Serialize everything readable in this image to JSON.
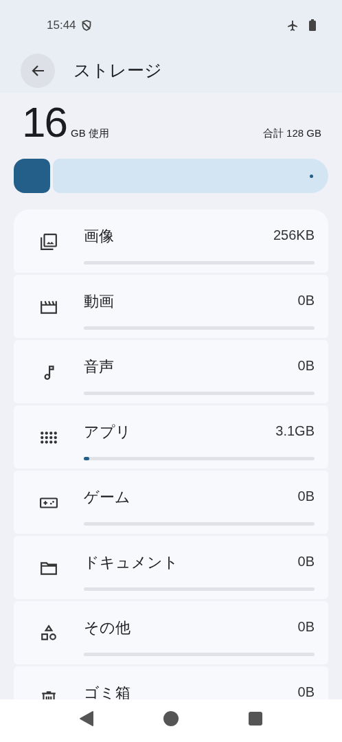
{
  "status_bar": {
    "time": "15:44"
  },
  "app_bar": {
    "title": "ストレージ"
  },
  "summary": {
    "used": "16",
    "used_unit": "GB 使用",
    "total": "合計 128 GB",
    "level": 0.125
  },
  "categories": [
    {
      "kind": "images",
      "label": "画像",
      "size": "256KB",
      "level": 0
    },
    {
      "kind": "video",
      "label": "動画",
      "size": "0B",
      "level": 0
    },
    {
      "kind": "audio",
      "label": "音声",
      "size": "0B",
      "level": 0
    },
    {
      "kind": "apps",
      "label": "アプリ",
      "size": "3.1GB",
      "level": 0.024
    },
    {
      "kind": "games",
      "label": "ゲーム",
      "size": "0B",
      "level": 0
    },
    {
      "kind": "documents",
      "label": "ドキュメント",
      "size": "0B",
      "level": 0
    },
    {
      "kind": "other",
      "label": "その他",
      "size": "0B",
      "level": 0
    },
    {
      "kind": "trash",
      "label": "ゴミ箱",
      "size": "0B"
    }
  ]
}
